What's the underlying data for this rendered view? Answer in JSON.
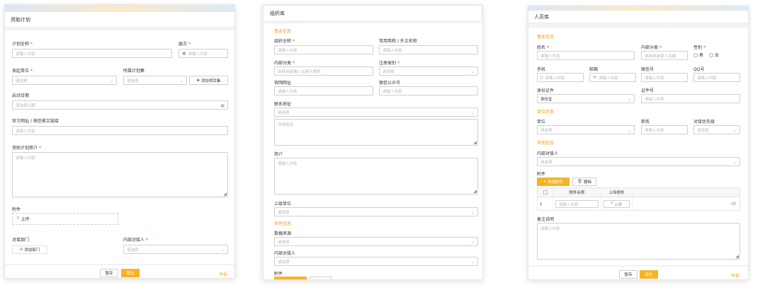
{
  "panel1": {
    "title": "资助计划",
    "plan_name_label": "计划全称",
    "plan_name_placeholder": "请输入内容",
    "session_label": "届次",
    "session_placeholder": "请输入内容",
    "initiator_label": "发起单位",
    "initiator_placeholder": "请选择",
    "plan_set_label": "所属计划集",
    "plan_set_placeholder": "请选择",
    "add_set_button": "添加项目集",
    "start_date_label": "启动日期",
    "start_date_placeholder": "请选择日期",
    "website_label": "官方网址 / 微信推文链接",
    "website_placeholder": "请输入内容",
    "intro_label": "资助计划简介",
    "intro_placeholder": "请输入内容",
    "attachment_label": "附件",
    "upload_button": "上传",
    "dept_label": "对接部门",
    "add_dept_button": "添加部门",
    "contact_label": "内部对接人",
    "contact_placeholder": "请选择",
    "save_button": "暂存",
    "submit_button": "提交",
    "cancel_link": "举报"
  },
  "panel2": {
    "title": "组织库",
    "basic_section": "基本信息",
    "fullname_label": "组织全称",
    "fullname_placeholder": "请输入内容",
    "shortname_label": "常用简称 / 外文名称",
    "shortname_placeholder": "请输入内容",
    "category_label": "内部分类",
    "category_placeholder": "选择或者输入关键字搜索",
    "regtype_label": "注册类别",
    "regtype_placeholder": "请选择",
    "website_label": "官网网址",
    "website_placeholder": "请输入内容",
    "wechat_label": "微信公众号",
    "wechat_placeholder": "请输入内容",
    "address_label": "联系地址",
    "address_placeholder": "请选择",
    "address_detail_placeholder": "详细地址",
    "intro_label": "简介",
    "intro_placeholder": "请输入内容",
    "parent_label": "上级单位",
    "parent_placeholder": "请选择",
    "other_section": "其他信息",
    "source_label": "数据来源",
    "source_placeholder": "请选择",
    "contact_label": "内部对接人",
    "contact_placeholder": "请选择",
    "attachment_label": "附件"
  },
  "panel3": {
    "title": "人员库",
    "basic_section": "基本信息",
    "name_label": "姓名",
    "name_placeholder": "请输入内容",
    "category_label": "内部分类",
    "category_placeholder": "选择或者输入关键",
    "gender_label": "性别",
    "gender_male": "男",
    "gender_female": "女",
    "phone_label": "手机",
    "phone_placeholder": "请输入内容",
    "email_label": "邮箱",
    "email_placeholder": "请输入内容",
    "wechat_label": "微信号",
    "wechat_placeholder": "请输入内容",
    "qq_label": "QQ号",
    "qq_placeholder": "请输入内容",
    "idtype_label": "身份证件",
    "idtype_value": "身份证",
    "idnum_label": "证件号",
    "idnum_placeholder": "请输入内容",
    "unit_section": "单位信息",
    "unit_label": "单位",
    "unit_placeholder": "请选择",
    "position_label": "职务",
    "position_placeholder": "请输入内容",
    "priority_label": "对接优先级",
    "priority_placeholder": "请选择",
    "other_section": "其他信息",
    "contact_label": "内部对接人",
    "contact_placeholder": "请选择",
    "attachment_label": "附件",
    "add_attachment_button": "添加附件",
    "delete_button": "删除",
    "col_name": "附件名称",
    "col_upload": "上传附件",
    "row_index": "1",
    "row_name_placeholder": "请输入内容",
    "row_upload_button": "上传",
    "remark_label": "备注说明",
    "remark_placeholder": "请输入内容",
    "save_button": "暂存",
    "submit_button": "提交",
    "cancel_link": "举报"
  }
}
